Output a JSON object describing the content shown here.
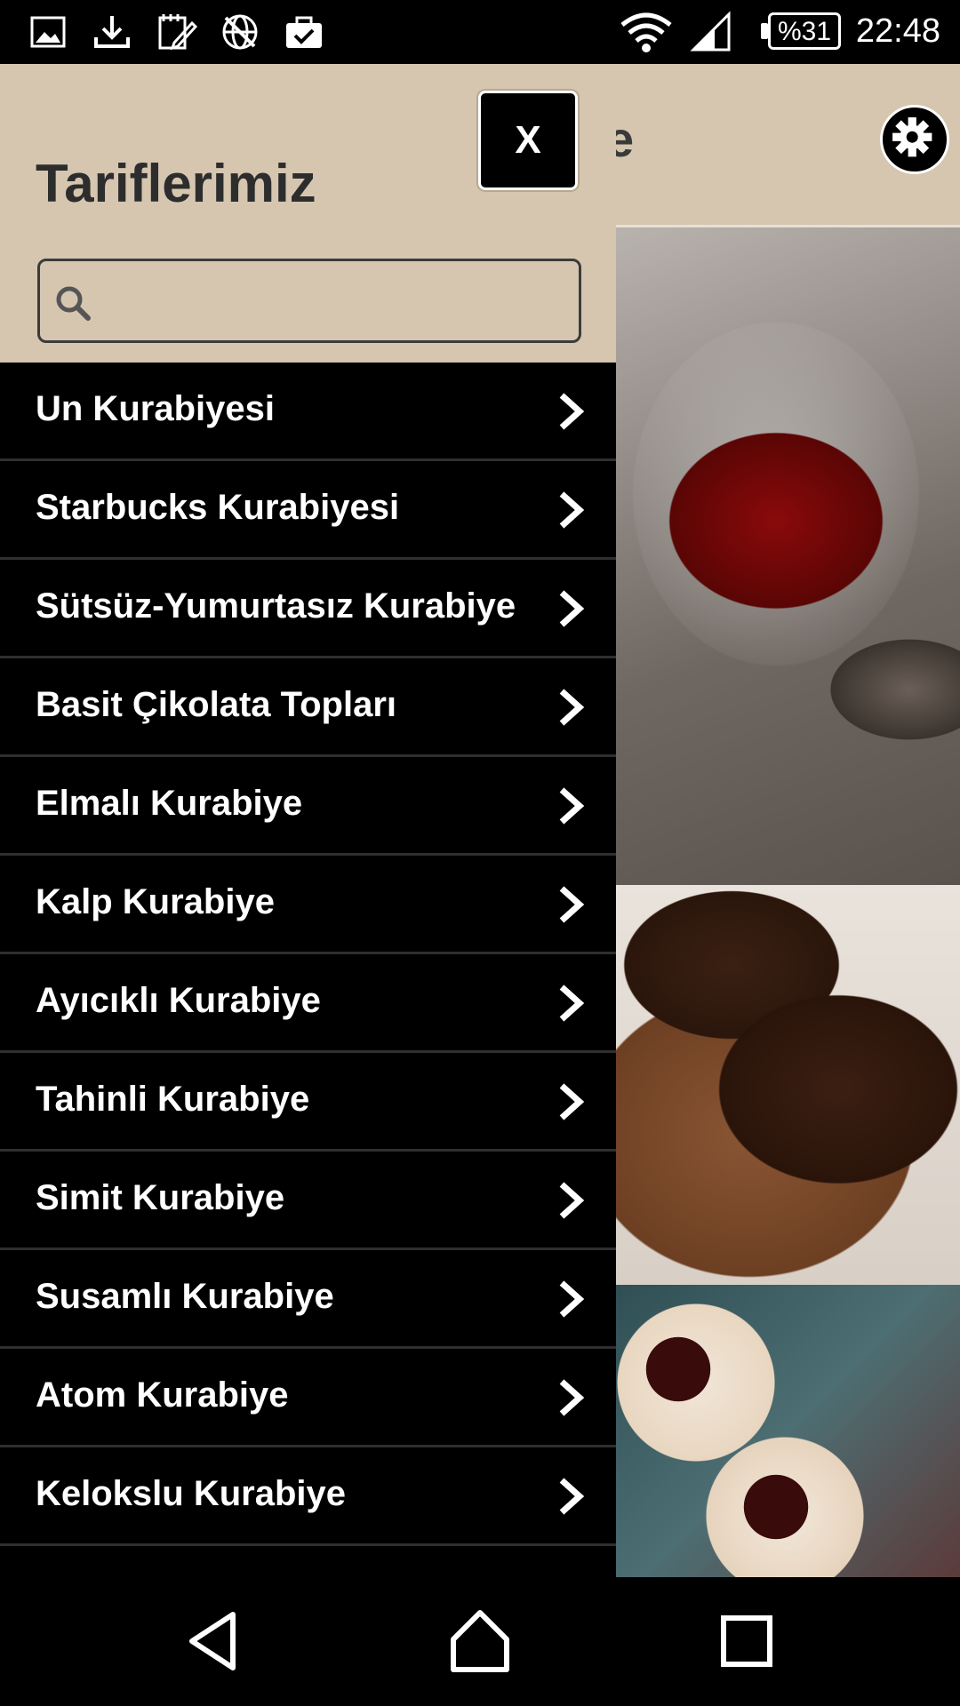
{
  "status_bar": {
    "icons": [
      "image-icon",
      "download-icon",
      "edit-note-icon",
      "no-network-globe-icon",
      "briefcase-check-icon",
      "wifi-icon",
      "cell-signal-icon"
    ],
    "battery": "%31",
    "time": "22:48"
  },
  "background_app": {
    "title_fragment": "e",
    "settings_icon": "gear-icon"
  },
  "drawer": {
    "title": "Tariflerimiz",
    "close_label": "X",
    "search": {
      "value": "",
      "placeholder": ""
    },
    "items": [
      {
        "label": "Un Kurabiyesi"
      },
      {
        "label": "Starbucks Kurabiyesi"
      },
      {
        "label": "Sütsüz-Yumurtasız Kurabiye"
      },
      {
        "label": "Basit Çikolata Topları"
      },
      {
        "label": "Elmalı Kurabiye"
      },
      {
        "label": "Kalp Kurabiye"
      },
      {
        "label": "Ayıcıklı Kurabiye"
      },
      {
        "label": "Tahinli Kurabiye"
      },
      {
        "label": "Simit Kurabiye"
      },
      {
        "label": "Susamlı Kurabiye"
      },
      {
        "label": "Atom Kurabiye"
      },
      {
        "label": "Kelokslu Kurabiye"
      }
    ]
  },
  "nav_bar": {
    "icons": [
      "back-icon",
      "home-icon",
      "recents-icon"
    ]
  },
  "colors": {
    "header_beige": "#d6c6b0",
    "drawer_bg": "#000000",
    "divider": "#2f2f2f",
    "text_dark": "#2d2d2d",
    "text_light": "#ffffff"
  }
}
